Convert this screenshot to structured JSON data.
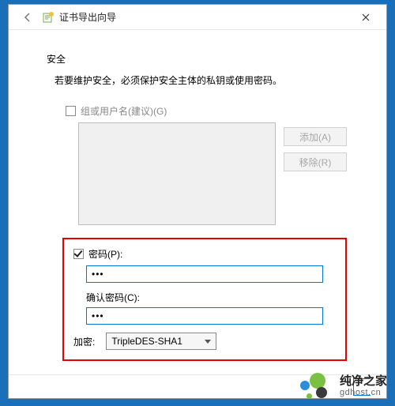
{
  "window": {
    "title": "证书导出向导",
    "close_glyph": "✕",
    "back_glyph": "←"
  },
  "page": {
    "heading": "安全",
    "description": "若要维护安全，必须保护安全主体的私钥或使用密码。"
  },
  "group": {
    "checkbox_label": "组或用户名(建议)(G)",
    "add_button": "添加(A)",
    "remove_button": "移除(R)"
  },
  "password": {
    "checkbox_label": "密码(P):",
    "value": "•••",
    "confirm_label": "确认密码(C):",
    "confirm_value": "•••"
  },
  "encryption": {
    "label": "加密:",
    "selected": "TripleDES-SHA1"
  },
  "watermark": {
    "name": "纯净之家",
    "url": "gdhost.cn"
  }
}
